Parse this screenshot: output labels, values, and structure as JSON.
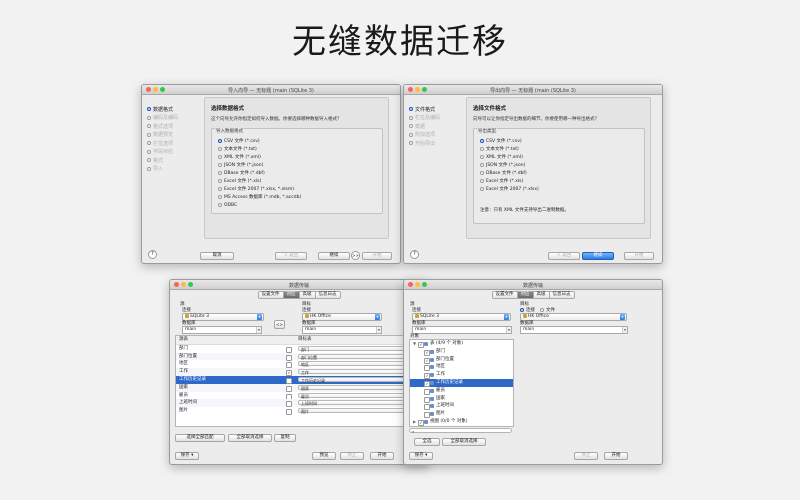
{
  "headline": "无缝数据迁移",
  "win1": {
    "title": "导入向导 — 无标题 (main (SQLite 3)",
    "steps": [
      {
        "label": "数据格式",
        "active": true
      },
      {
        "label": "编码及编码",
        "active": false
      },
      {
        "label": "格式选项",
        "active": false
      },
      {
        "label": "数据预览",
        "active": false
      },
      {
        "label": "栏位选项",
        "active": false
      },
      {
        "label": "字段对应",
        "active": false
      },
      {
        "label": "格式",
        "active": false
      },
      {
        "label": "导入",
        "active": false
      }
    ],
    "heading": "选择数据格式",
    "description": "这个向导允许你指定如何导入数据。你要选择哪种数据导入格式？",
    "group_label": "导入数据格式",
    "formats": [
      {
        "label": "CSV 文件 (*.csv)",
        "selected": true
      },
      {
        "label": "文本文件 (*.txt)",
        "selected": false
      },
      {
        "label": "XML 文件 (*.xml)",
        "selected": false
      },
      {
        "label": "JSON 文件 (*.json)",
        "selected": false
      },
      {
        "label": "DBase 文件 (*.dbf)",
        "selected": false
      },
      {
        "label": "Excel 文件 (*.xls)",
        "selected": false
      },
      {
        "label": "Excel 文件 2007 (*.xlsx, *.xlsm)",
        "selected": false
      },
      {
        "label": "MS Access 数据库 (*.mdb, *.accdb)",
        "selected": false
      },
      {
        "label": "ODBC",
        "selected": false
      }
    ],
    "cancel": "取消",
    "back": "< 返回",
    "next": "继续",
    "start": "开始",
    "help": "?",
    "skip": ">>"
  },
  "win2": {
    "title": "导出向导 — 无标题 (main (SQLite 3)",
    "steps": [
      {
        "label": "文件格式",
        "active": true
      },
      {
        "label": "栏位及编码",
        "active": false
      },
      {
        "label": "数据",
        "active": false
      },
      {
        "label": "附加选项",
        "active": false
      },
      {
        "label": "开始导出",
        "active": false
      }
    ],
    "heading": "选择文件格式",
    "description": "向导可以让你指定导出数据的细节。你要使用哪一种导出格式？",
    "group_label": "导出类型",
    "formats": [
      {
        "label": "CSV 文件 (*.csv)",
        "selected": true
      },
      {
        "label": "文本文件 (*.txt)",
        "selected": false
      },
      {
        "label": "XML 文件 (*.xml)",
        "selected": false
      },
      {
        "label": "JSON 文件 (*.json)",
        "selected": false
      },
      {
        "label": "DBase 文件 (*.dbf)",
        "selected": false
      },
      {
        "label": "Excel 文件 (*.xls)",
        "selected": false
      },
      {
        "label": "Excel 文件 2007 (*.xlsx)",
        "selected": false
      }
    ],
    "note": "注意：只有 XML 文件支持导出二进制数据。",
    "back": "< 返回",
    "next": "继续",
    "start": "开始",
    "help": "?"
  },
  "win3": {
    "title": "数据传输",
    "tabs": [
      {
        "label": "设置文件",
        "selected": false
      },
      {
        "label": "对应",
        "selected": true
      },
      {
        "label": "高级",
        "selected": false
      },
      {
        "label": "信息日志",
        "selected": false
      }
    ],
    "src_label": "源",
    "tgt_label": "目标",
    "conn_label": "连接",
    "src_conn": "SQLite 3",
    "tgt_conn": "HK Office",
    "db_label": "数据库",
    "src_db": "main",
    "tgt_db": "main",
    "swap": "<>",
    "col_src": "源表",
    "col_tgt": "目标表",
    "rows": [
      {
        "src": "部门",
        "checked": false,
        "tgt": "部门"
      },
      {
        "src": "部门位置",
        "checked": false,
        "tgt": "部门位置"
      },
      {
        "src": "地区",
        "checked": false,
        "tgt": "地区"
      },
      {
        "src": "工作",
        "checked": true,
        "tgt": "工作"
      },
      {
        "src": "工作历史记录",
        "checked": false,
        "tgt": "工作历史记录"
      },
      {
        "src": "国家",
        "checked": false,
        "tgt": "国家"
      },
      {
        "src": "雇员",
        "checked": false,
        "tgt": "雇员"
      },
      {
        "src": "上班时间",
        "checked": false,
        "tgt": "上班时间"
      },
      {
        "src": "图片",
        "checked": false,
        "tgt": "图片"
      }
    ],
    "btn_select_all": "选择全部匹配",
    "btn_deselect_all": "全部取消选择",
    "btn_copy": "复制",
    "save": "保存",
    "preview": "预览",
    "stop": "停止",
    "start": "开始"
  },
  "win4": {
    "title": "数据传输",
    "tabs": [
      {
        "label": "设置文件",
        "selected": false
      },
      {
        "label": "对应",
        "selected": true
      },
      {
        "label": "高级",
        "selected": false
      },
      {
        "label": "信息日志",
        "selected": false
      }
    ],
    "src_label": "源",
    "tgt_label": "目标",
    "conn_label": "连接",
    "src_conn": "SQLite 3",
    "tgt_conn": "HK Office",
    "db_label": "数据库",
    "src_db": "main",
    "tgt_db": "main",
    "tgt_opt_conn": "连接",
    "tgt_opt_file": "文件",
    "objects_label": "对象",
    "tree": [
      {
        "label": "表 (4/9 个 对象)",
        "level": 0,
        "checked": true,
        "expand": true
      },
      {
        "label": "部门",
        "level": 1,
        "checked": true
      },
      {
        "label": "部门位置",
        "level": 1,
        "checked": true
      },
      {
        "label": "地区",
        "level": 1,
        "checked": false
      },
      {
        "label": "工作",
        "level": 1,
        "checked": true
      },
      {
        "label": "工作历史记录",
        "level": 1,
        "checked": true,
        "highlight": true
      },
      {
        "label": "雇员",
        "level": 1,
        "checked": false
      },
      {
        "label": "国家",
        "level": 1,
        "checked": false
      },
      {
        "label": "上班时间",
        "level": 1,
        "checked": false
      },
      {
        "label": "图片",
        "level": 1,
        "checked": false
      },
      {
        "label": "视图 (0/0 个 对象)",
        "level": 0,
        "checked": true,
        "expand": false
      }
    ],
    "btn_select_all": "全选",
    "btn_deselect_all": "全部取消选择",
    "save": "保存",
    "stop": "停止",
    "start": "开始"
  }
}
